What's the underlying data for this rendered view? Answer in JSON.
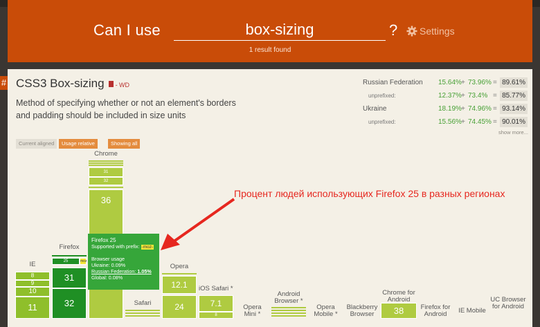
{
  "header": {
    "question_prefix": "Can I use",
    "search_value": "box-sizing",
    "question_mark": "?",
    "settings_label": "Settings",
    "results": "1 result found"
  },
  "feature": {
    "hash": "#",
    "title": "CSS3 Box-sizing",
    "status": "- WD",
    "description": "Method of specifying whether or not an element's borders and padding should be included in size units"
  },
  "stats": [
    {
      "label": "Russian Federation",
      "a": "15.64%",
      "plus": "+",
      "b": "73.96%",
      "eq": "=",
      "total": "89.61%"
    },
    {
      "label": "unprefixed:",
      "a": "12.37%",
      "plus": "+",
      "b": "73.4%",
      "eq": "=",
      "total": "85.77%"
    },
    {
      "label": "Ukraine",
      "a": "18.19%",
      "plus": "+",
      "b": "74.96%",
      "eq": "=",
      "total": "93.14%"
    },
    {
      "label": "unprefixed:",
      "a": "15.56%",
      "plus": "+",
      "b": "74.45%",
      "eq": "=",
      "total": "90.01%"
    }
  ],
  "show_more": "show more...",
  "view_buttons": [
    "Current aligned",
    "Usage relative",
    "Showing all"
  ],
  "browsers": {
    "ie": "IE",
    "firefox": "Firefox",
    "chrome": "Chrome",
    "safari": "Safari",
    "opera": "Opera",
    "ios_safari": "iOS Safari *",
    "opera_mini": "Opera Mini *",
    "android": "Android Browser *",
    "opera_mobile": "Opera Mobile *",
    "blackberry": "Blackberry Browser",
    "chrome_android": "Chrome for Android",
    "firefox_android": "Firefox for Android",
    "ie_mobile": "IE Mobile",
    "uc_android": "UC Browser for Android"
  },
  "versions": {
    "ie": [
      "8",
      "9",
      "10",
      "11"
    ],
    "firefox": [
      "31",
      "32"
    ],
    "firefox_small": "25",
    "chrome_small": [
      "31",
      "32"
    ],
    "chrome_main": "36",
    "opera": "12.1",
    "opera_main": "24",
    "ios": "7.1",
    "ios_small": "8",
    "chrome_android": "38"
  },
  "tooltip": {
    "title": "Firefox 25",
    "support": "Supported with prefix:",
    "prefix": "-moz-",
    "usage_title": "Browser usage",
    "ukraine": "Ukraine: 0.09%",
    "russia_label": "Russian Federation:",
    "russia_value": "1.05%",
    "global": "Global: 0.08%"
  },
  "annotation": "Процент людей использующих Firefox 25 в разных регионах",
  "colors": {
    "accent": "#c94c08",
    "supported": "#39a636",
    "annotation": "#e6271f"
  }
}
